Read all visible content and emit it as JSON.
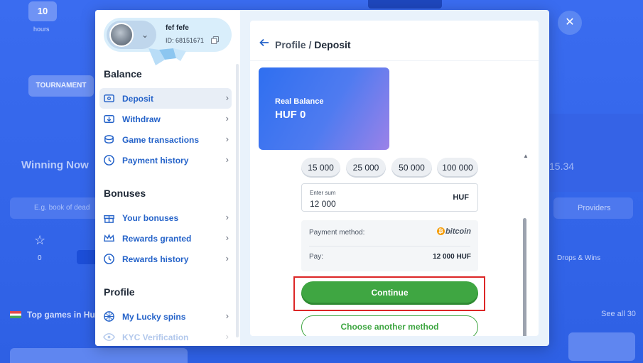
{
  "background": {
    "hours_value": "10",
    "hours_label": "hours",
    "tournament_label": "TOURNAMENT",
    "winning_now": "Winning Now",
    "search_placeholder": "E.g. book of dead",
    "star_count": "0",
    "providers_label": "Providers",
    "drops_label": "Drops & Wins",
    "top_games_label": "Top games in Hu",
    "see_all_label": "See all 30",
    "close_icon": "close-icon"
  },
  "profile": {
    "name": "fef fefe",
    "id_label": "ID: 68151671"
  },
  "menu": {
    "balance_title": "Balance",
    "balance_items": [
      {
        "label": "Deposit",
        "icon": "deposit-icon",
        "active": true
      },
      {
        "label": "Withdraw",
        "icon": "withdraw-icon"
      },
      {
        "label": "Game transactions",
        "icon": "coins-icon"
      },
      {
        "label": "Payment history",
        "icon": "clock-icon"
      }
    ],
    "bonuses_title": "Bonuses",
    "bonus_items": [
      {
        "label": "Your bonuses",
        "icon": "gift-icon"
      },
      {
        "label": "Rewards granted",
        "icon": "crown-icon"
      },
      {
        "label": "Rewards history",
        "icon": "clock-icon"
      }
    ],
    "profile_title": "Profile",
    "profile_items": [
      {
        "label": "My Lucky spins",
        "icon": "spins-icon"
      },
      {
        "label": "KYC Verification",
        "icon": "eye-icon"
      }
    ]
  },
  "content": {
    "breadcrumb_parent": "Profile",
    "breadcrumb_sep": " / ",
    "breadcrumb_current": "Deposit",
    "balance_label": "Real Balance",
    "balance_value": "HUF 0",
    "amount_chips": [
      "15 000",
      "25 000",
      "50 000",
      "100 000"
    ],
    "sum_label": "Enter sum",
    "sum_value": "12 000",
    "sum_currency": "HUF",
    "payment_method_label": "Payment method:",
    "payment_method_name": "bitcoin",
    "pay_label": "Pay:",
    "pay_value": "12 000 HUF",
    "continue_label": "Continue",
    "another_method_label": "Choose another method"
  },
  "colors": {
    "accent_blue": "#2563c9",
    "green": "#3fa642",
    "highlight_red": "#dc2626"
  }
}
